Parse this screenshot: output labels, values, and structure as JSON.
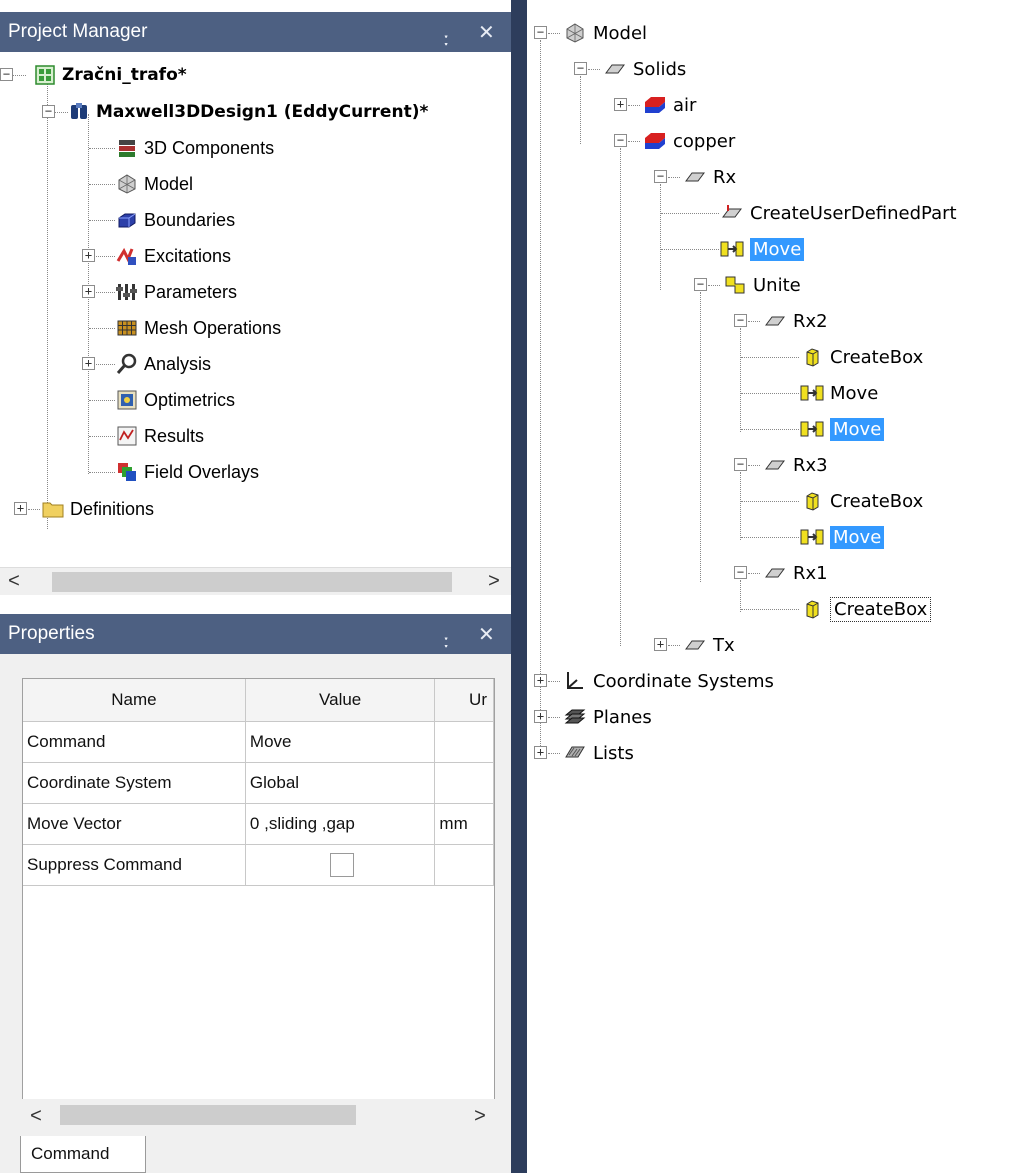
{
  "project_manager": {
    "title": "Project Manager",
    "pin_glyph": "࿒",
    "close_glyph": "✕",
    "tree": {
      "project": "Zračni_trafo*",
      "design": "Maxwell3DDesign1 (EddyCurrent)*",
      "items": [
        "3D Components",
        "Model",
        "Boundaries",
        "Excitations",
        "Parameters",
        "Mesh Operations",
        "Analysis",
        "Optimetrics",
        "Results",
        "Field Overlays"
      ],
      "definitions": "Definitions"
    },
    "scroll_left": "<",
    "scroll_right": ">"
  },
  "properties": {
    "title": "Properties",
    "pin_glyph": "࿒",
    "close_glyph": "✕",
    "columns": [
      "Name",
      "Value",
      "Ur"
    ],
    "rows": [
      {
        "name": "Command",
        "value": "Move",
        "unit": ""
      },
      {
        "name": "Coordinate System",
        "value": "Global",
        "unit": ""
      },
      {
        "name": "Move Vector",
        "value": "0 ,sliding ,gap",
        "unit": "mm"
      },
      {
        "name": "Suppress Command",
        "value": "",
        "unit": ""
      }
    ],
    "suppress_checked": false,
    "scroll_left": "<",
    "scroll_right": ">",
    "tab": "Command"
  },
  "model_tree": {
    "root": "Model",
    "solids": "Solids",
    "air": "air",
    "copper": "copper",
    "rx": "Rx",
    "create_user_defined_part": "CreateUserDefinedPart",
    "move_1": "Move",
    "unite": "Unite",
    "rx2": "Rx2",
    "rx2_createbox": "CreateBox",
    "rx2_move_a": "Move",
    "rx2_move_b": "Move",
    "rx3": "Rx3",
    "rx3_createbox": "CreateBox",
    "rx3_move": "Move",
    "rx1": "Rx1",
    "rx1_createbox": "CreateBox",
    "tx": "Tx",
    "coordinate_systems": "Coordinate Systems",
    "planes": "Planes",
    "lists": "Lists"
  },
  "colors": {
    "title_bar": "#4d6082",
    "divider": "#2d3d5c",
    "selection": "#3399ff"
  }
}
